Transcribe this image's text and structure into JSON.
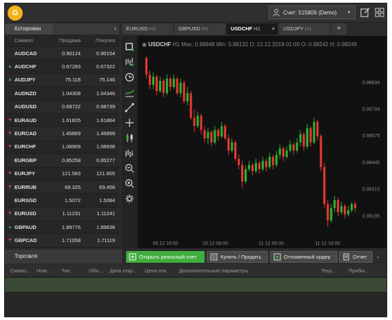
{
  "header": {
    "logo_letter": "G",
    "account_label": "Счет: 515809 (Demo)"
  },
  "quotes": {
    "tab_label": "Котировки",
    "columns": {
      "symbol": "Символ",
      "sell": "Продажа",
      "buy": "Покупка"
    },
    "rows": [
      {
        "symbol": "AUDCAD",
        "trend": "none",
        "sell": "0.90124",
        "buy": "0.90154"
      },
      {
        "symbol": "AUDCHF",
        "trend": "up",
        "sell": "0.67283",
        "buy": "0.67322"
      },
      {
        "symbol": "AUDJPY",
        "trend": "up",
        "sell": "75.118",
        "buy": "75.146"
      },
      {
        "symbol": "AUDNZD",
        "trend": "none",
        "sell": "1.04308",
        "buy": "1.04346"
      },
      {
        "symbol": "AUDUSD",
        "trend": "none",
        "sell": "0.68722",
        "buy": "0.68739"
      },
      {
        "symbol": "EURAUD",
        "trend": "down",
        "sell": "1.61825",
        "buy": "1.61864"
      },
      {
        "symbol": "EURCAD",
        "trend": "down",
        "sell": "1.45869",
        "buy": "1.45899"
      },
      {
        "symbol": "EURCHF",
        "trend": "down",
        "sell": "1.08909",
        "buy": "1.08938"
      },
      {
        "symbol": "EURGBP",
        "trend": "none",
        "sell": "0.85258",
        "buy": "0.85277"
      },
      {
        "symbol": "EURJPY",
        "trend": "down",
        "sell": "121.583",
        "buy": "121.605"
      },
      {
        "symbol": "EURRUB",
        "trend": "down",
        "sell": "69.325",
        "buy": "69.458"
      },
      {
        "symbol": "EURSGD",
        "trend": "none",
        "sell": "1.5072",
        "buy": "1.5084"
      },
      {
        "symbol": "EURUSD",
        "trend": "down",
        "sell": "1.11231",
        "buy": "1.11241"
      },
      {
        "symbol": "GBPAUD",
        "trend": "up",
        "sell": "1.89776",
        "buy": "1.89838"
      },
      {
        "symbol": "GBPCAD",
        "trend": "down",
        "sell": "1.71058",
        "buy": "1.71119"
      }
    ]
  },
  "tabs": [
    {
      "symbol": "EURUSD",
      "tf": "H1",
      "active": false
    },
    {
      "symbol": "GBPUSD",
      "tf": "H1",
      "active": false
    },
    {
      "symbol": "USDCHF",
      "tf": "H1",
      "active": true
    },
    {
      "symbol": "USDJPY",
      "tf": "H1",
      "active": false
    }
  ],
  "tab_add_label": "+",
  "chart_header": {
    "symbol": "USDCHF",
    "timeframe": "H1",
    "ohlc_text": "Max: 0.98948  Min: 0.98132  D: 12.12.2019 01:00  O: 0.98242  H: 0.98249"
  },
  "chart_data": {
    "type": "candlestick",
    "y_axis_ticks": [
      "0.98834",
      "0.98704",
      "0.98575",
      "0.98445",
      "0.98315",
      "0.98185"
    ],
    "y_axis_values": [
      0.98834,
      0.98704,
      0.98575,
      0.98445,
      0.98315,
      0.98185
    ],
    "x_axis_ticks": [
      "09.12 16:00",
      "10.12 08:00",
      "11.12 00:00",
      "11.12 16:00"
    ],
    "ylim": [
      0.98112,
      0.98958
    ],
    "up_color": "#2db32d",
    "down_color": "#e53935",
    "candles": [
      [
        0.9895,
        0.9896,
        0.9885,
        0.9887
      ],
      [
        0.9887,
        0.9889,
        0.988,
        0.9882
      ],
      [
        0.9882,
        0.9888,
        0.988,
        0.9886
      ],
      [
        0.9886,
        0.9887,
        0.9877,
        0.9879
      ],
      [
        0.9879,
        0.9886,
        0.9878,
        0.9884
      ],
      [
        0.9884,
        0.9885,
        0.9876,
        0.9878
      ],
      [
        0.9878,
        0.9887,
        0.9877,
        0.9885
      ],
      [
        0.9885,
        0.9886,
        0.9879,
        0.9881
      ],
      [
        0.9881,
        0.9887,
        0.988,
        0.9885
      ],
      [
        0.9885,
        0.9886,
        0.9877,
        0.9878
      ],
      [
        0.9878,
        0.9885,
        0.9876,
        0.9883
      ],
      [
        0.9883,
        0.9884,
        0.9873,
        0.9874
      ],
      [
        0.9874,
        0.9881,
        0.9872,
        0.9878
      ],
      [
        0.9878,
        0.9879,
        0.9865,
        0.9866
      ],
      [
        0.9866,
        0.987,
        0.9859,
        0.9862
      ],
      [
        0.9862,
        0.9869,
        0.9861,
        0.9867
      ],
      [
        0.9867,
        0.9868,
        0.9858,
        0.986
      ],
      [
        0.986,
        0.9862,
        0.9854,
        0.9856
      ],
      [
        0.9856,
        0.9861,
        0.9853,
        0.9859
      ],
      [
        0.9859,
        0.986,
        0.9852,
        0.9854
      ],
      [
        0.9854,
        0.9862,
        0.9853,
        0.986
      ],
      [
        0.986,
        0.9861,
        0.9855,
        0.9857
      ],
      [
        0.9857,
        0.9864,
        0.9856,
        0.9862
      ],
      [
        0.9862,
        0.9863,
        0.9855,
        0.9856
      ],
      [
        0.9856,
        0.9858,
        0.9848,
        0.985
      ],
      [
        0.985,
        0.9856,
        0.9849,
        0.9854
      ],
      [
        0.9854,
        0.9855,
        0.9845,
        0.9846
      ],
      [
        0.9846,
        0.9848,
        0.9841,
        0.9843
      ],
      [
        0.9843,
        0.9845,
        0.9832,
        0.9835
      ],
      [
        0.9835,
        0.9843,
        0.9834,
        0.9841
      ],
      [
        0.9841,
        0.9845,
        0.984,
        0.9843
      ],
      [
        0.9843,
        0.9844,
        0.9838,
        0.984
      ],
      [
        0.984,
        0.9846,
        0.9839,
        0.9844
      ],
      [
        0.9844,
        0.9845,
        0.9839,
        0.9841
      ],
      [
        0.9841,
        0.9847,
        0.984,
        0.9845
      ],
      [
        0.9845,
        0.9846,
        0.984,
        0.9842
      ],
      [
        0.9842,
        0.9849,
        0.9841,
        0.9847
      ],
      [
        0.9847,
        0.9848,
        0.9841,
        0.9843
      ],
      [
        0.9843,
        0.985,
        0.9842,
        0.9848
      ],
      [
        0.9848,
        0.9853,
        0.9846,
        0.9851
      ],
      [
        0.9851,
        0.9852,
        0.9845,
        0.9847
      ],
      [
        0.9847,
        0.9852,
        0.9846,
        0.985
      ],
      [
        0.985,
        0.9855,
        0.9849,
        0.9853
      ],
      [
        0.9853,
        0.9854,
        0.9848,
        0.985
      ],
      [
        0.985,
        0.9856,
        0.9849,
        0.9854
      ],
      [
        0.9854,
        0.986,
        0.9852,
        0.9858
      ],
      [
        0.9858,
        0.9859,
        0.985,
        0.9852
      ],
      [
        0.9852,
        0.9863,
        0.9851,
        0.9861
      ],
      [
        0.9861,
        0.9862,
        0.9852,
        0.9854
      ],
      [
        0.9854,
        0.9866,
        0.9853,
        0.9864
      ],
      [
        0.9864,
        0.9865,
        0.9855,
        0.9857
      ],
      [
        0.9857,
        0.9858,
        0.984,
        0.9842
      ],
      [
        0.9842,
        0.9844,
        0.9822,
        0.9824
      ],
      [
        0.9824,
        0.9826,
        0.9813,
        0.9816
      ],
      [
        0.9816,
        0.9824,
        0.9815,
        0.9822
      ],
      [
        0.9822,
        0.9828,
        0.982,
        0.9826
      ],
      [
        0.9826,
        0.9827,
        0.9818,
        0.982
      ],
      [
        0.982,
        0.9825,
        0.9819,
        0.9823
      ],
      [
        0.9823,
        0.9824,
        0.9817,
        0.9819
      ],
      [
        0.9819,
        0.9823,
        0.9818,
        0.9821
      ],
      [
        0.9821,
        0.9825,
        0.982,
        0.9824
      ],
      [
        0.9824,
        0.9825,
        0.982,
        0.9822
      ]
    ]
  },
  "actions": {
    "trade_tab": "Торговля",
    "open_real": "Открыть реальный счет",
    "buy_sell": "Купить / Продать",
    "pending": "Отложенный ордер",
    "report": "Отчет"
  },
  "trade_table": {
    "columns": [
      "Симво...",
      "Ном...",
      "Тип",
      "Объ...",
      "Дата откр...",
      "Цена отк...",
      "Дополнительные параметры",
      "Теку...",
      "Прибы..."
    ]
  }
}
